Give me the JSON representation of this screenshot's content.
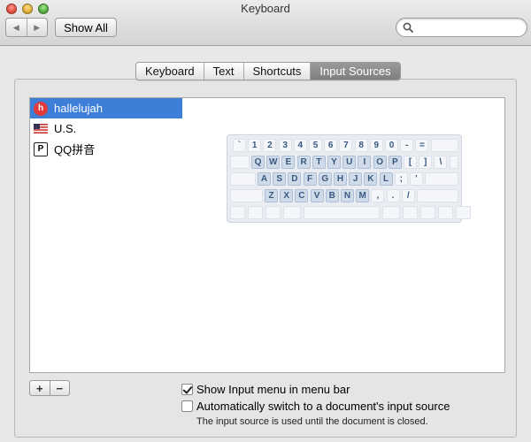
{
  "window": {
    "title": "Keyboard"
  },
  "toolbar": {
    "back_glyph": "◀",
    "forward_glyph": "▶",
    "show_all_label": "Show All",
    "search_placeholder": ""
  },
  "tabs": [
    {
      "label": "Keyboard",
      "selected": false
    },
    {
      "label": "Text",
      "selected": false
    },
    {
      "label": "Shortcuts",
      "selected": false
    },
    {
      "label": "Input Sources",
      "selected": true
    }
  ],
  "input_sources": [
    {
      "label": "hallelujah",
      "icon": "hallelujah-icon",
      "icon_glyph": "h",
      "selected": true
    },
    {
      "label": "U.S.",
      "icon": "us-flag-icon",
      "selected": false
    },
    {
      "label": "QQ拼音",
      "icon": "qq-pinyin-icon",
      "icon_glyph": "P",
      "selected": false
    }
  ],
  "keyboard_rows": [
    [
      "`",
      "1",
      "2",
      "3",
      "4",
      "5",
      "6",
      "7",
      "8",
      "9",
      "0",
      "-",
      "="
    ],
    [
      "Q",
      "W",
      "E",
      "R",
      "T",
      "Y",
      "U",
      "I",
      "O",
      "P",
      "[",
      "]",
      "\\"
    ],
    [
      "A",
      "S",
      "D",
      "F",
      "G",
      "H",
      "J",
      "K",
      "L",
      ";",
      "'"
    ],
    [
      "Z",
      "X",
      "C",
      "V",
      "B",
      "N",
      "M",
      ",",
      ".",
      "/"
    ]
  ],
  "list_controls": {
    "add_label": "+",
    "remove_label": "−"
  },
  "options": {
    "show_input_menu": {
      "label": "Show Input menu in menu bar",
      "checked": true
    },
    "auto_switch": {
      "label": "Automatically switch to a document's input source",
      "checked": false
    },
    "note": "The input source is used until the document is closed."
  },
  "colors": {
    "selection": "#3d7ed9",
    "key_label": "#38587f",
    "tab_selected": "#878787"
  }
}
